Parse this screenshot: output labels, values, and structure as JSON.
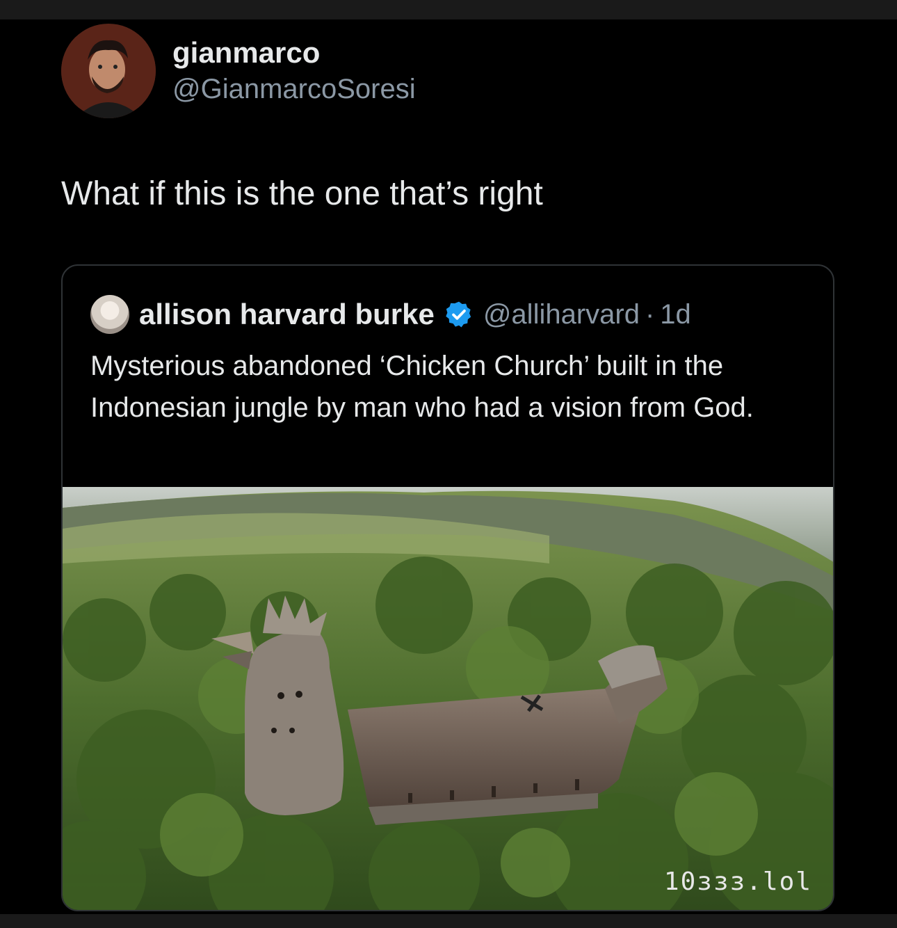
{
  "tweet": {
    "author": {
      "display_name": "gianmarco",
      "handle": "@GianmarcoSoresi"
    },
    "text": "What if this is the one that’s right"
  },
  "quoted_tweet": {
    "author": {
      "display_name": "allison harvard burke",
      "handle": "@alliharvard",
      "verified_icon": "verified-badge-icon"
    },
    "separator": "·",
    "time": "1d",
    "text": "Mysterious abandoned ‘Chicken Church’ built in the Indonesian jungle by man who had a vision from God.",
    "image_alt": "Aerial photo of the chicken-shaped church in a forest"
  },
  "watermark": "10ɜɜɜ.lol",
  "colors": {
    "background": "#000000",
    "text": "#e7e9ea",
    "secondary_text": "#8b98a5",
    "verified": "#1d9bf0",
    "border": "#2f3336"
  }
}
